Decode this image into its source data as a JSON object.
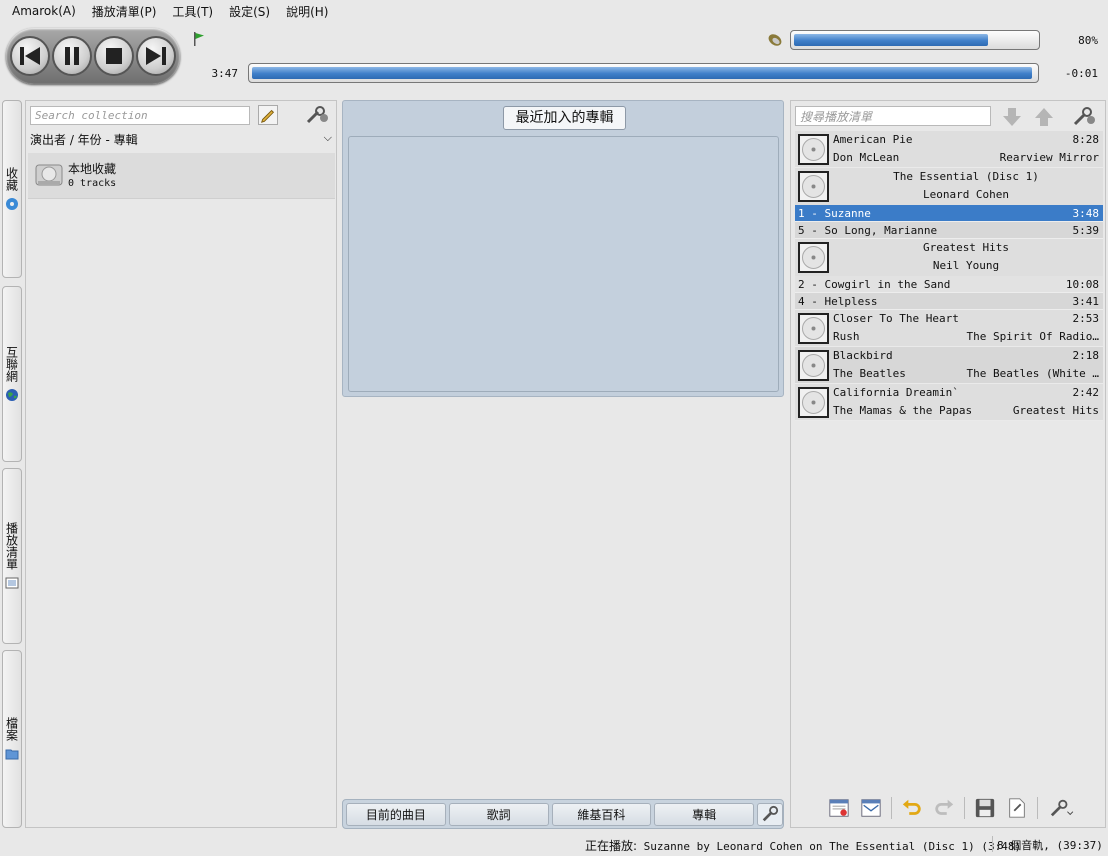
{
  "menubar": {
    "items": [
      "Amarok(A)",
      "播放清單(P)",
      "工具(T)",
      "設定(S)",
      "說明(H)"
    ]
  },
  "transport": {
    "buttons": [
      "previous-icon",
      "pause-icon",
      "stop-icon",
      "next-icon"
    ],
    "volume_percent": 80,
    "volume_label": "80%",
    "elapsed": "3:47",
    "remaining": "-0:01",
    "seek_fraction": 0.996
  },
  "sidebar_tabs": [
    {
      "label": "收藏",
      "icon": "disc-icon"
    },
    {
      "label": "互聯網",
      "icon": "globe-icon"
    },
    {
      "label": "播放清單",
      "icon": "playlist-icon"
    },
    {
      "label": "檔案",
      "icon": "folder-icon"
    }
  ],
  "collection": {
    "search_placeholder": "Search collection",
    "group_by": "演出者 / 年份 - 專輯",
    "items": [
      {
        "name": "本地收藏",
        "subtitle": "0 tracks"
      }
    ]
  },
  "context": {
    "applet_title": "最近加入的專輯",
    "tabs": [
      "目前的曲目",
      "歌詞",
      "維基百科",
      "專輯"
    ]
  },
  "playlist": {
    "search_placeholder": "搜尋播放清單",
    "heads": [
      {
        "title": "American Pie",
        "length": "8:28",
        "artist": "Don McLean",
        "album": "Rearview Mirror"
      }
    ],
    "groups": [
      {
        "album": "The Essential (Disc 1)",
        "artist": "Leonard Cohen",
        "tracks": [
          {
            "label": "1 - Suzanne",
            "length": "3:48"
          },
          {
            "label": "5 - So Long, Marianne",
            "length": "5:39"
          }
        ]
      },
      {
        "album": "Greatest Hits",
        "artist": "Neil Young",
        "tracks": [
          {
            "label": "2 - Cowgirl in the Sand",
            "length": "10:08"
          },
          {
            "label": "4 - Helpless",
            "length": "3:41"
          }
        ]
      }
    ],
    "singles": [
      {
        "title": "Closer To The Heart",
        "length": "2:53",
        "artist": "Rush",
        "album": "The Spirit Of Radio…"
      },
      {
        "title": "Blackbird",
        "length": "2:18",
        "artist": "The Beatles",
        "album": "The Beatles (White …"
      },
      {
        "title": "California Dreamin`",
        "length": "2:42",
        "artist": "The Mamas & the Papas",
        "album": "Greatest Hits"
      }
    ]
  },
  "status": {
    "now_playing_prefix": "正在播放:",
    "now_playing": "Suzanne by Leonard Cohen on The Essential (Disc 1) (3:48)",
    "track_count": "8 個音軌, (39:37)"
  },
  "colors": {
    "accent": "#3b7cc8",
    "context_bg": "#c3cfdc"
  }
}
